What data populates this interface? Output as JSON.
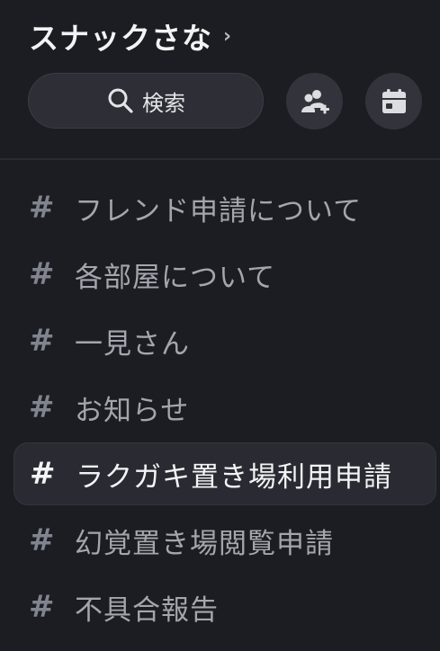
{
  "header": {
    "server_name": "スナックさな",
    "chevron": "›"
  },
  "toolbar": {
    "search_label": "検索",
    "search_icon": "magnifier-icon",
    "invite_icon": "add-member-icon",
    "events_icon": "calendar-icon"
  },
  "channels": {
    "hash_symbol": "#",
    "items": [
      {
        "name": "フレンド申請について",
        "selected": false
      },
      {
        "name": "各部屋について",
        "selected": false
      },
      {
        "name": "一見さん",
        "selected": false
      },
      {
        "name": "お知らせ",
        "selected": false
      },
      {
        "name": "ラクガキ置き場利用申請",
        "selected": true
      },
      {
        "name": "幻覚置き場閲覧申請",
        "selected": false
      },
      {
        "name": "不具合報告",
        "selected": false
      }
    ]
  },
  "colors": {
    "background": "#1c1d22",
    "selected_row": "#2a2b32",
    "muted_text": "#a3a6ad",
    "bright_text": "#f2f3f5"
  }
}
